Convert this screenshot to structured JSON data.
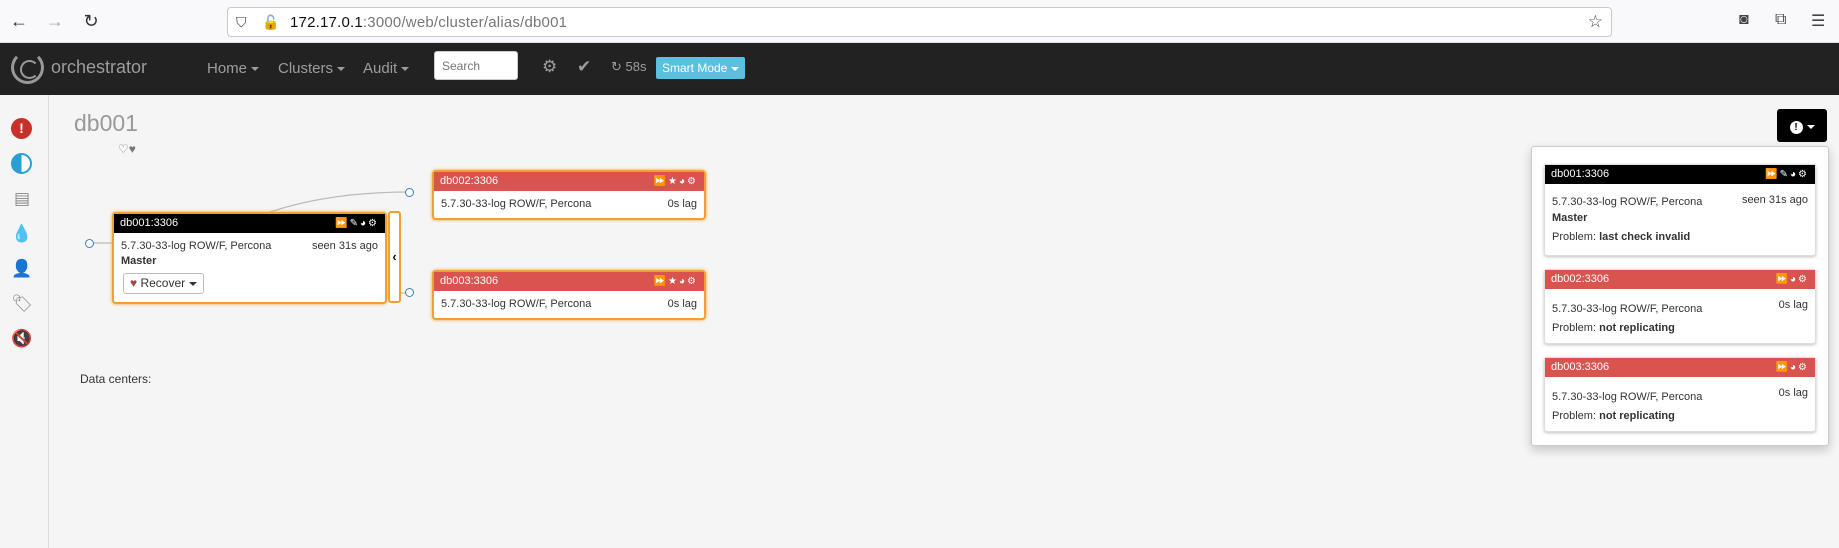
{
  "browser": {
    "url_host": "172.17.0.1",
    "url_rest": ":3000/web/cluster/alias/db001"
  },
  "navbar": {
    "brand": "orchestrator",
    "menus": [
      "Home",
      "Clusters",
      "Audit"
    ],
    "search_placeholder": "Search",
    "refresh_countdown": "58s",
    "mode_label": "Smart Mode"
  },
  "sidebar": {
    "icons": [
      "problems-icon",
      "contrast-icon",
      "news-icon",
      "drop-icon",
      "user-icon",
      "tag-icon",
      "mute-icon"
    ]
  },
  "cluster": {
    "title": "db001",
    "favorites": "♡♥",
    "datacenters_label": "Data centers:"
  },
  "topology": {
    "master": {
      "name": "db001:3306",
      "version": "5.7.30-33-log ROW/F, Percona",
      "seen": "seen 31s ago",
      "role": "Master",
      "recover_label": "Recover",
      "head_color": "#000000"
    },
    "replicas": [
      {
        "name": "db002:3306",
        "version": "5.7.30-33-log ROW/F, Percona",
        "lag": "0s lag",
        "head_color": "#d9534f"
      },
      {
        "name": "db003:3306",
        "version": "5.7.30-33-log ROW/F, Percona",
        "lag": "0s lag",
        "head_color": "#d9534f"
      }
    ]
  },
  "problems": {
    "cards": [
      {
        "name": "db001:3306",
        "version": "5.7.30-33-log ROW/F, Percona",
        "lag": "seen 31s ago",
        "role": "Master",
        "problem_label": "Problem:",
        "problem": "last check invalid"
      },
      {
        "name": "db002:3306",
        "version": "5.7.30-33-log ROW/F, Percona",
        "lag": "0s lag",
        "role": "",
        "problem_label": "Problem:",
        "problem": "not replicating"
      },
      {
        "name": "db003:3306",
        "version": "5.7.30-33-log ROW/F, Percona",
        "lag": "0s lag",
        "role": "",
        "problem_label": "Problem:",
        "problem": "not replicating"
      }
    ]
  },
  "colors": {
    "navbar": "#222222",
    "highlight_border": "#f0a030",
    "problem_red": "#d9534f",
    "info_blue": "#5bc0de"
  }
}
